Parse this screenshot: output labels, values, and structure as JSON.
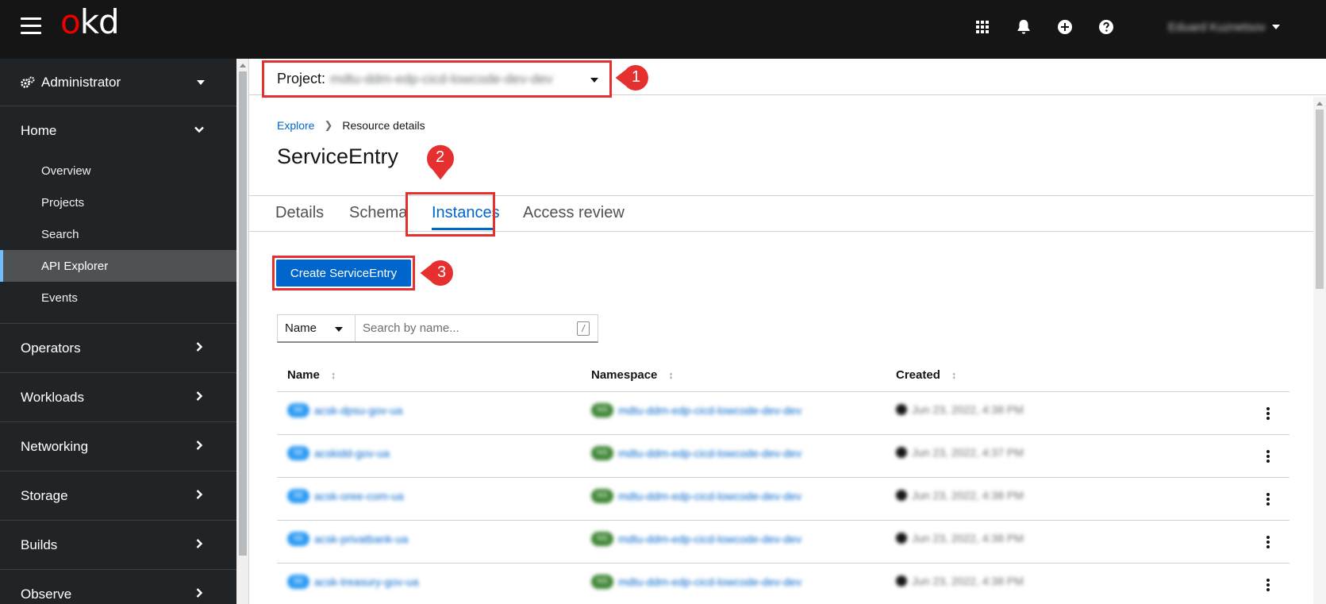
{
  "masthead": {
    "logo": {
      "o": "o",
      "rest": "kd"
    },
    "icons": [
      "grid-icon",
      "bell-icon",
      "plus-circle-icon",
      "question-circle-icon"
    ],
    "user_name": "Eduard Kuznetsov"
  },
  "sidebar": {
    "perspective": "Administrator",
    "home": {
      "label": "Home",
      "items": [
        "Overview",
        "Projects",
        "Search",
        "API Explorer",
        "Events"
      ],
      "active": "API Explorer"
    },
    "sections": [
      "Operators",
      "Workloads",
      "Networking",
      "Storage",
      "Builds",
      "Observe"
    ]
  },
  "project": {
    "label": "Project:",
    "name": "mdtu-ddm-edp-cicd-lowcode-dev-dev"
  },
  "callouts": [
    "1",
    "2",
    "3"
  ],
  "breadcrumb": {
    "link": "Explore",
    "current": "Resource details"
  },
  "page_title": "ServiceEntry",
  "tabs": [
    "Details",
    "Schema",
    "Instances",
    "Access review"
  ],
  "active_tab": "Instances",
  "create_button": "Create ServiceEntry",
  "filter": {
    "select": "Name",
    "placeholder": "Search by name...",
    "shortcut": "/"
  },
  "table": {
    "headers": [
      "Name",
      "Namespace",
      "Created"
    ],
    "rows": [
      {
        "badge": "SE",
        "name": "acsk-dpsu-gov-ua",
        "ns_badge": "NS",
        "namespace": "mdtu-ddm-edp-cicd-lowcode-dev-dev",
        "created": "Jun 23, 2022, 4:38 PM"
      },
      {
        "badge": "SE",
        "name": "acskidd-gov-ua",
        "ns_badge": "NS",
        "namespace": "mdtu-ddm-edp-cicd-lowcode-dev-dev",
        "created": "Jun 23, 2022, 4:37 PM"
      },
      {
        "badge": "SE",
        "name": "acsk-oree-com-ua",
        "ns_badge": "NS",
        "namespace": "mdtu-ddm-edp-cicd-lowcode-dev-dev",
        "created": "Jun 23, 2022, 4:38 PM"
      },
      {
        "badge": "SE",
        "name": "acsk-privatbank-ua",
        "ns_badge": "NS",
        "namespace": "mdtu-ddm-edp-cicd-lowcode-dev-dev",
        "created": "Jun 23, 2022, 4:38 PM"
      },
      {
        "badge": "SE",
        "name": "acsk-treasury-gov-ua",
        "ns_badge": "NS",
        "namespace": "mdtu-ddm-edp-cicd-lowcode-dev-dev",
        "created": "Jun 23, 2022, 4:38 PM"
      }
    ]
  },
  "colors": {
    "accent": "#0066cc",
    "callout": "#e63030",
    "masthead": "#151515",
    "sidebar": "#212427"
  }
}
